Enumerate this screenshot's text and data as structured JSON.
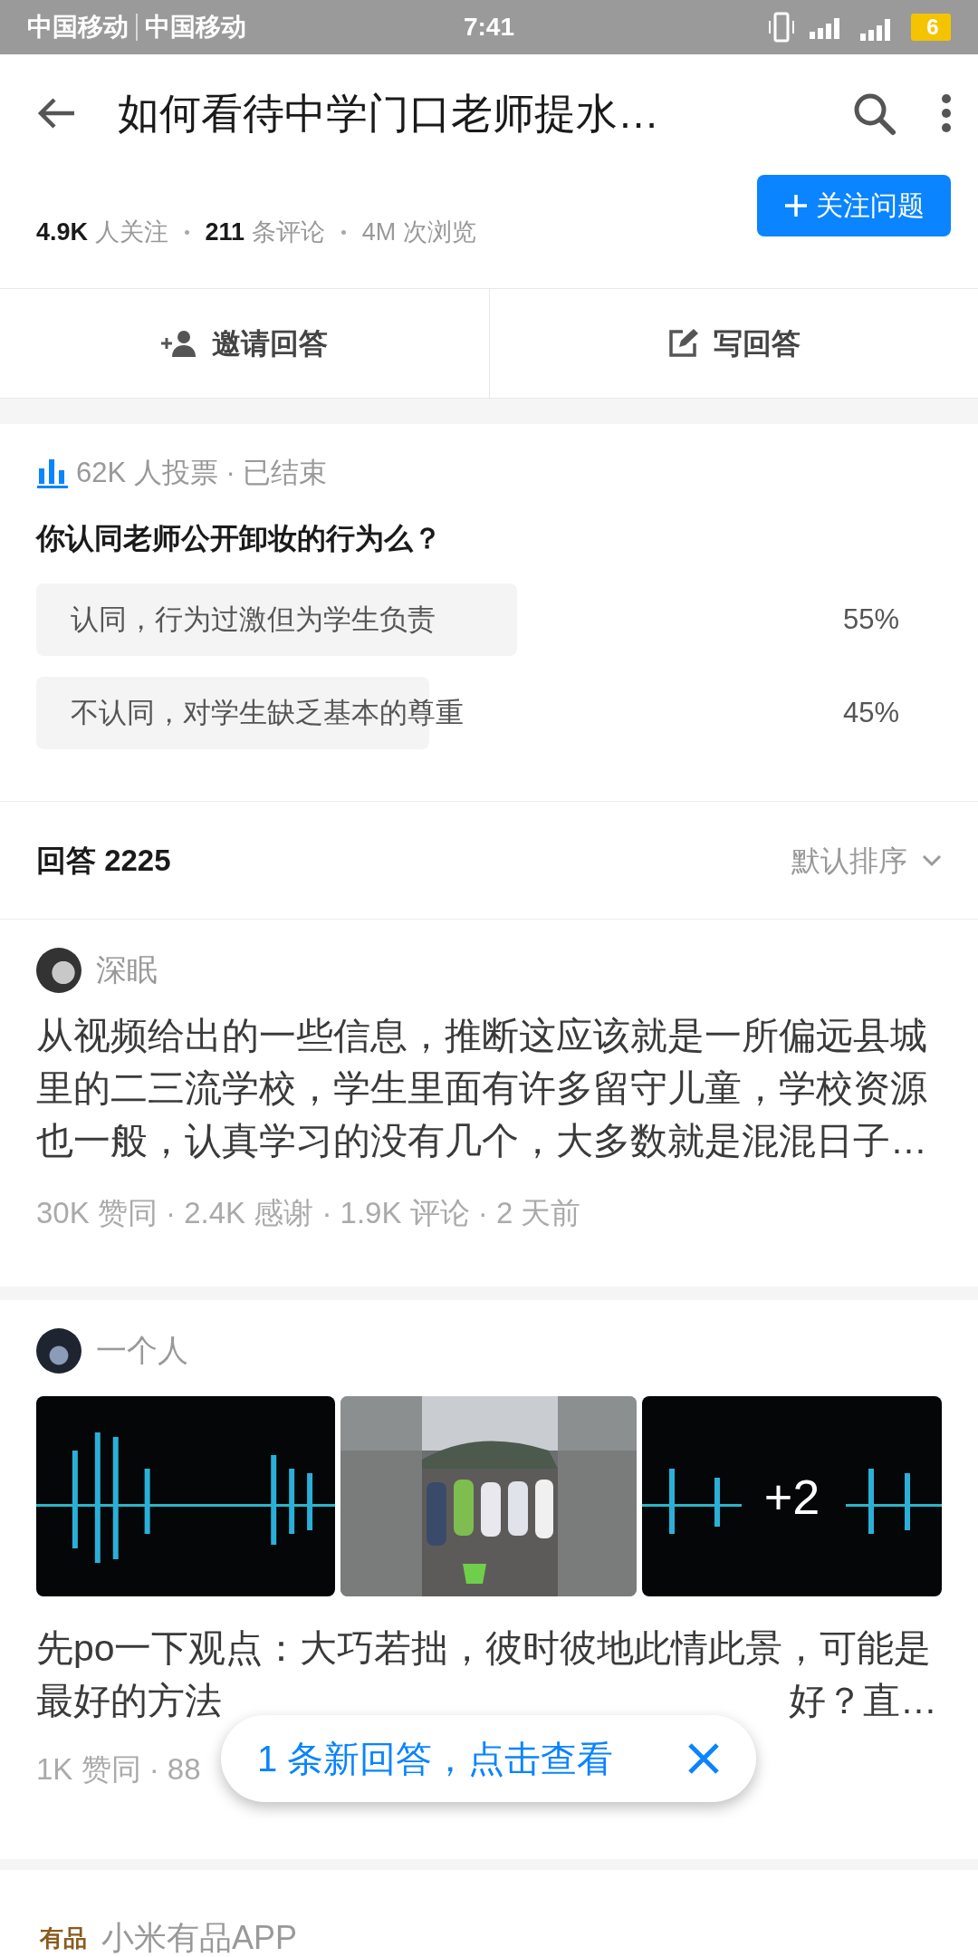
{
  "status_bar": {
    "carriers": [
      "中国移动",
      "中国移动"
    ],
    "time": "7:41",
    "battery": "6"
  },
  "toolbar": {
    "title": "如何看待中学门口老师提水…"
  },
  "question_stats": [
    "**4.9K** 人关注",
    "**211** 条评论",
    "4M 次浏览"
  ],
  "follow_button": "关注问题",
  "actions": [
    {
      "kind": "invite",
      "label": "邀请回答"
    },
    {
      "kind": "write",
      "label": "写回答"
    }
  ],
  "poll": {
    "summary": "62K 人投票 · 已结束",
    "question": "你认同老师公开卸妆的行为么？",
    "options": [
      {
        "label": "认同，行为过激但为学生负责",
        "percent": "55%"
      },
      {
        "label": "不认同，对学生缺乏基本的尊重",
        "percent": "45%"
      }
    ]
  },
  "answers_header": {
    "title": "回答 2225",
    "sort": "默认排序"
  },
  "answers": [
    {
      "author": "深眠",
      "text": "从视频给出的一些信息，推断这应该就是一所偏远县城里的二三流学校，学生里面有许多留守儿童，学校资源也一般，认真学习的没有几个，大多数就是混混日子…",
      "meta": "30K 赞同 · 2.4K 感谢 · 1.9K 评论 · 2 天前"
    },
    {
      "author": "一个人",
      "images": [
        {
          "kind": "picture"
        },
        {
          "kind": "picture"
        },
        {
          "kind": "picture",
          "overlay": "+2"
        }
      ],
      "text": "先po一下观点：大巧若拙，彼时彼地此情此景，可能是",
      "covered_line": [
        "最好的方法",
        "好？直…"
      ],
      "meta": "1K 赞同 · 88"
    }
  ],
  "toast": {
    "text": "1 条新回答，点击查看"
  },
  "ad": {
    "logo": "有品",
    "title": "小米有品APP"
  }
}
